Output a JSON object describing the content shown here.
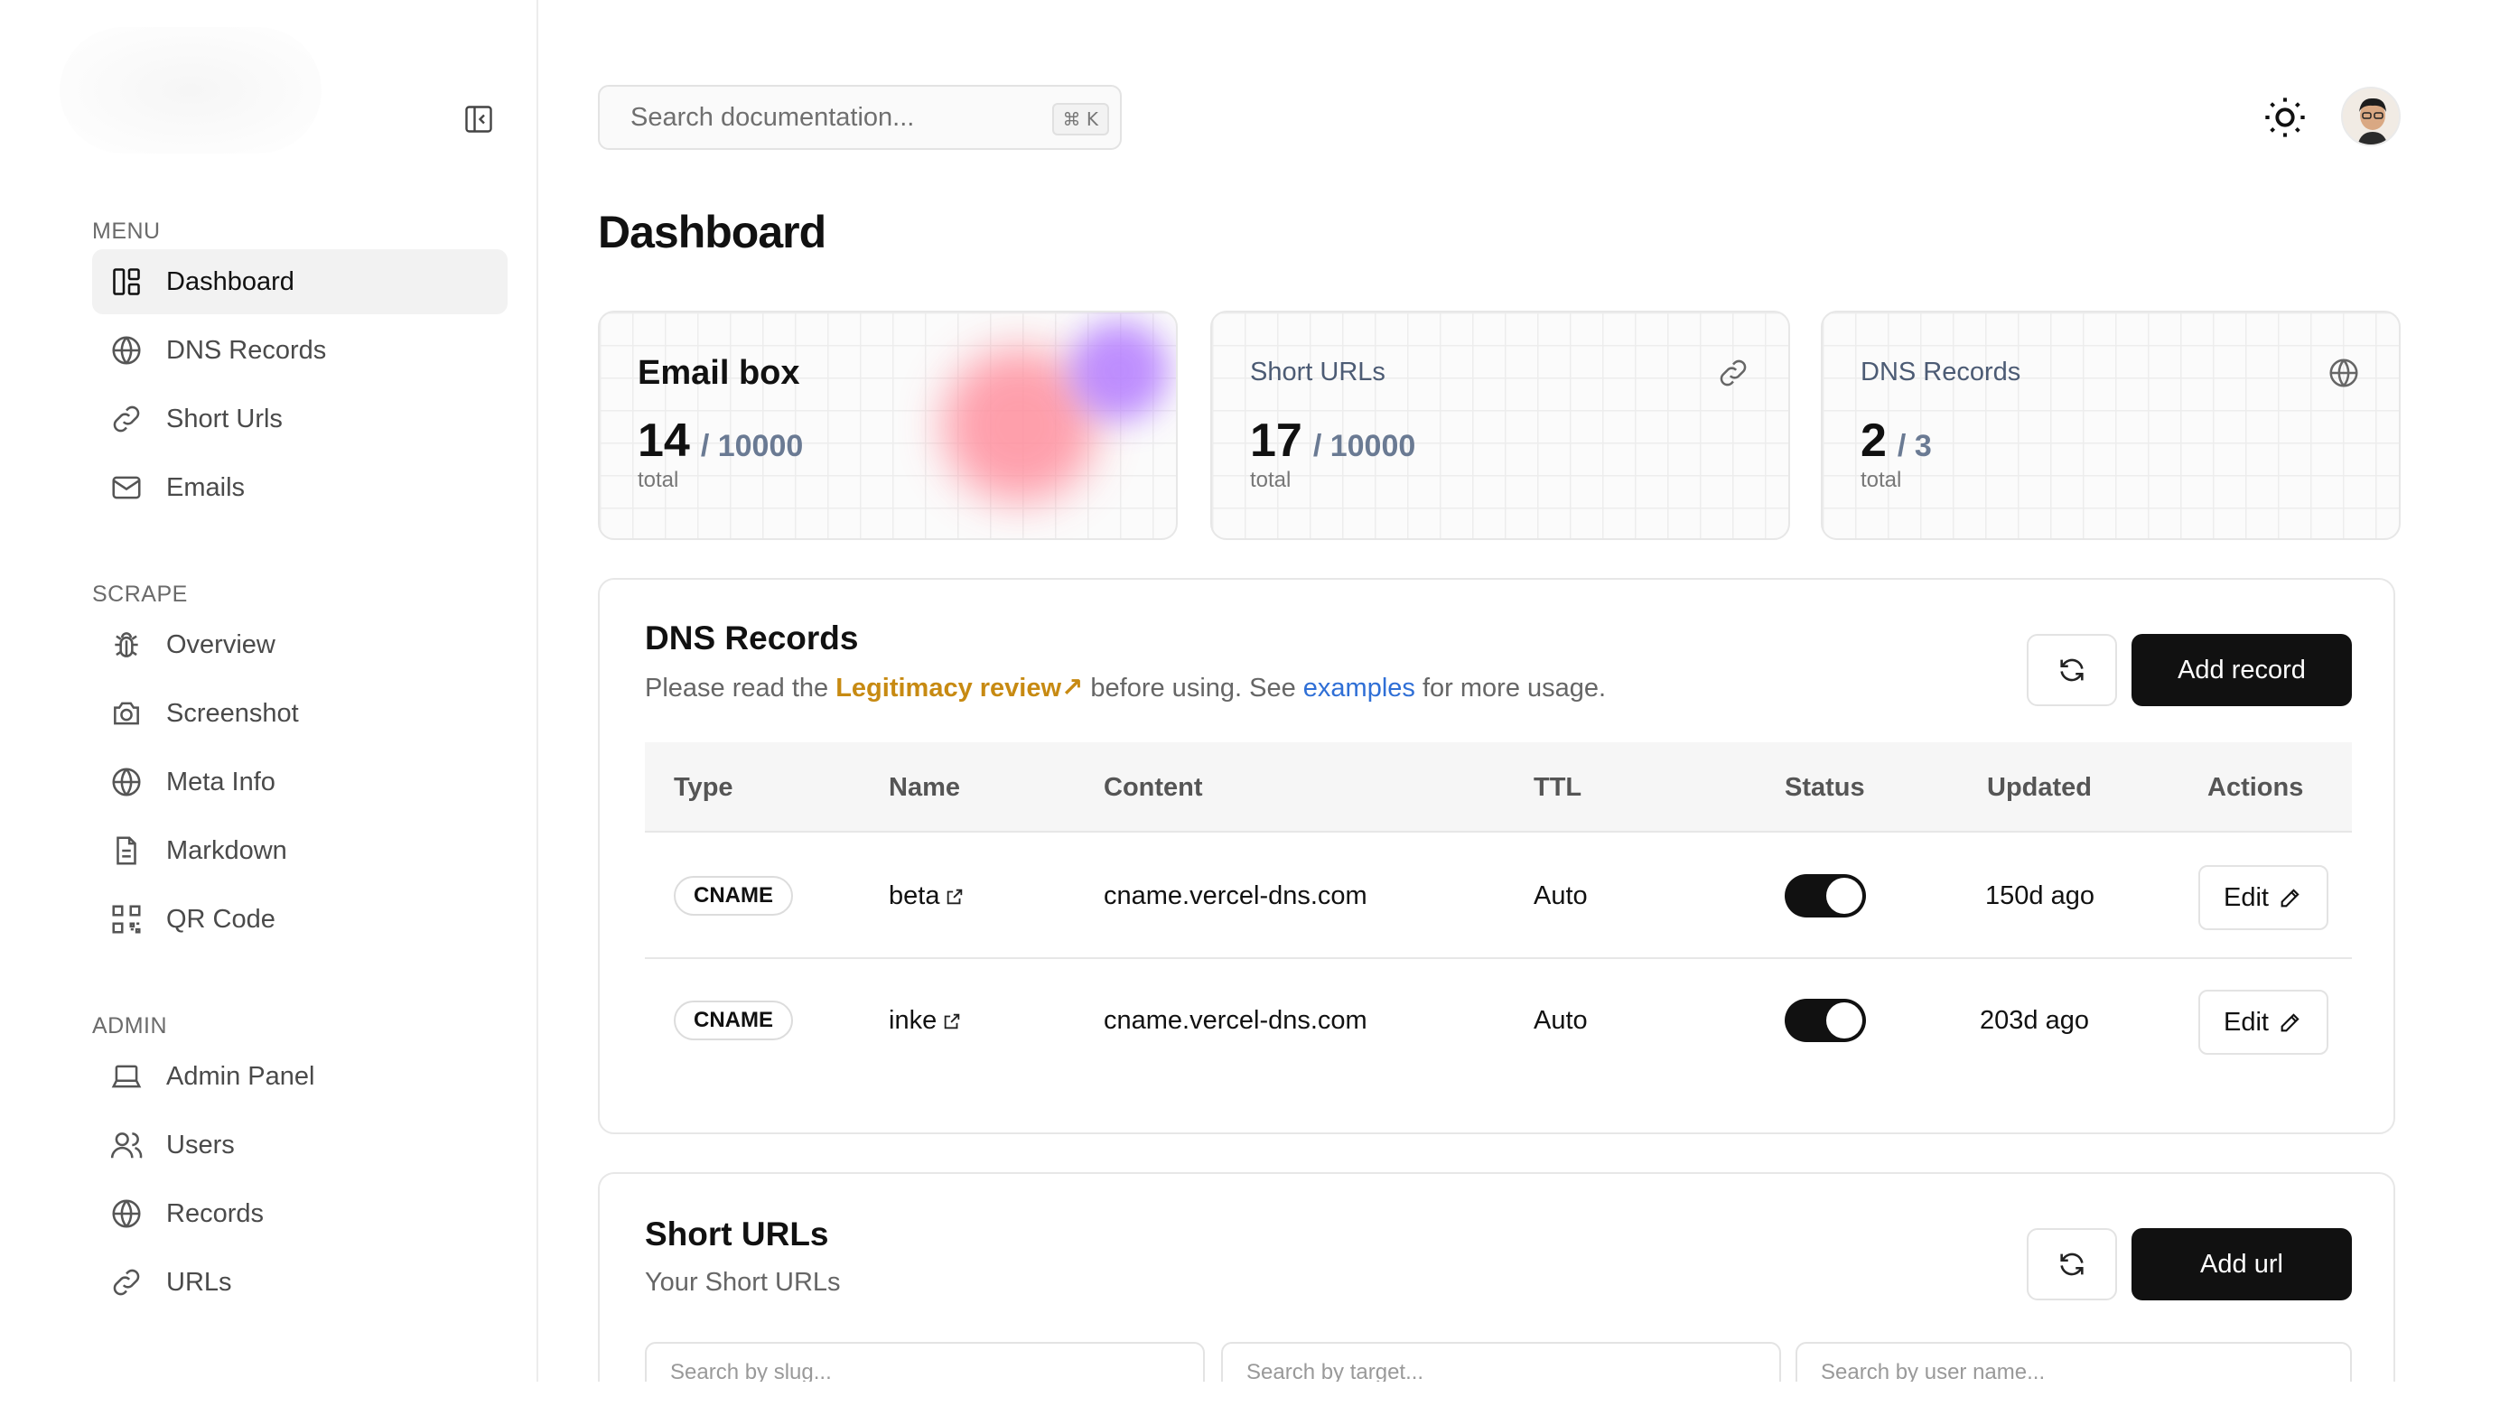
{
  "sidebar": {
    "sections": [
      {
        "label": "MENU",
        "items": [
          {
            "label": "Dashboard",
            "icon": "dashboard-icon",
            "active": true
          },
          {
            "label": "DNS Records",
            "icon": "globe-lock-icon"
          },
          {
            "label": "Short Urls",
            "icon": "link-icon"
          },
          {
            "label": "Emails",
            "icon": "mail-icon"
          }
        ]
      },
      {
        "label": "SCRAPE",
        "items": [
          {
            "label": "Overview",
            "icon": "bug-icon"
          },
          {
            "label": "Screenshot",
            "icon": "camera-icon"
          },
          {
            "label": "Meta Info",
            "icon": "globe-icon"
          },
          {
            "label": "Markdown",
            "icon": "file-text-icon"
          },
          {
            "label": "QR Code",
            "icon": "qr-code-icon"
          }
        ]
      },
      {
        "label": "ADMIN",
        "items": [
          {
            "label": "Admin Panel",
            "icon": "laptop-icon"
          },
          {
            "label": "Users",
            "icon": "users-icon"
          },
          {
            "label": "Records",
            "icon": "globe-icon"
          },
          {
            "label": "URLs",
            "icon": "link-icon"
          }
        ]
      }
    ]
  },
  "topbar": {
    "search_placeholder": "Search documentation...",
    "search_shortcut": "⌘ K"
  },
  "page": {
    "title": "Dashboard"
  },
  "stats": [
    {
      "title": "Email box",
      "value": "14",
      "limit": "/ 10000",
      "unit": "total"
    },
    {
      "title": "Short URLs",
      "value": "17",
      "limit": "/ 10000",
      "unit": "total",
      "icon": "link-icon"
    },
    {
      "title": "DNS Records",
      "value": "2",
      "limit": "/ 3",
      "unit": "total",
      "icon": "globe-lock-icon"
    }
  ],
  "dns_panel": {
    "title": "DNS Records",
    "subtitle_prefix": "Please read the ",
    "subtitle_warn": "Legitimacy review↗",
    "subtitle_mid": " before using. See ",
    "subtitle_link": "examples",
    "subtitle_suffix": " for more usage.",
    "add_label": "Add record",
    "columns": [
      "Type",
      "Name",
      "Content",
      "TTL",
      "Status",
      "Updated",
      "Actions"
    ],
    "rows": [
      {
        "type": "CNAME",
        "name": "beta",
        "content": "cname.vercel-dns.com",
        "ttl": "Auto",
        "status": true,
        "updated": "150d ago",
        "action": "Edit"
      },
      {
        "type": "CNAME",
        "name": "inke",
        "content": "cname.vercel-dns.com",
        "ttl": "Auto",
        "status": true,
        "updated": "203d ago",
        "action": "Edit"
      }
    ]
  },
  "urls_panel": {
    "title": "Short URLs",
    "subtitle": "Your Short URLs",
    "add_label": "Add url",
    "filters": [
      "Search by slug...",
      "Search by target...",
      "Search by user name..."
    ]
  },
  "colors": {
    "accent_dark": "#111111",
    "warn": "#c78a12",
    "link": "#2f6fd6"
  }
}
